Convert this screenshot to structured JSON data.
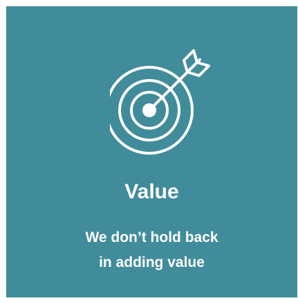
{
  "card": {
    "background_color": "#418c9b",
    "icon": "target-arrow-icon",
    "title": "Value",
    "subtitle_lines": [
      "We don’t hold back",
      "in adding value"
    ]
  }
}
